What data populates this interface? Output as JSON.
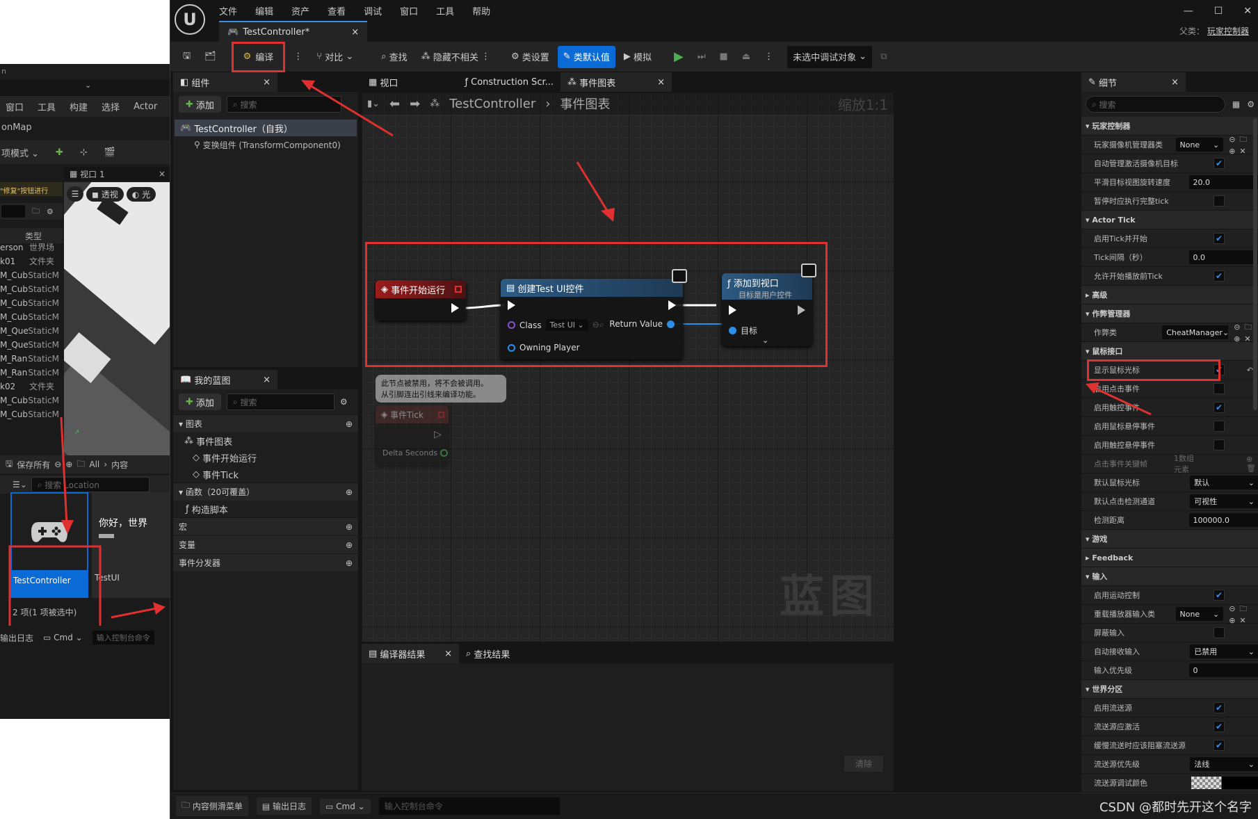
{
  "background_window": {
    "menu": [
      "窗口",
      "工具",
      "构建",
      "选择",
      "Actor"
    ],
    "map_label": "onMap",
    "mode_label": "项模式",
    "viewport_tab": "视口 1",
    "view_perspective": "透视",
    "view_lit": "光",
    "hint": "\"修复\"按钮进行",
    "type_header": "类型",
    "outliner_rows": [
      [
        "erson",
        "世界场"
      ],
      [
        "k01",
        "文件夹"
      ],
      [
        "M_Cub",
        "StaticM"
      ],
      [
        "M_Cub",
        "StaticM"
      ],
      [
        "M_Cub",
        "StaticM"
      ],
      [
        "M_Cub",
        "StaticM"
      ],
      [
        "M_Que",
        "StaticM"
      ],
      [
        "M_Que",
        "StaticM"
      ],
      [
        "M_Ran",
        "StaticM"
      ],
      [
        "M_Ran",
        "StaticM"
      ],
      [
        "k02",
        "文件夹"
      ],
      [
        "M_Cub",
        "StaticM"
      ],
      [
        "M_Cub",
        "StaticM"
      ]
    ],
    "save_all": "保存所有",
    "path_all": "All",
    "path_content": "内容",
    "search_placeholder": "搜索 Location",
    "assets": [
      {
        "name": "TestController",
        "selected": true
      },
      {
        "name": "TestUI",
        "preview_text": "你好，世界"
      }
    ],
    "items_count": "2 项(1 项被选中)",
    "output_log": "输出日志",
    "cmd": "Cmd",
    "console_placeholder": "输入控制台命令"
  },
  "title": {
    "menu": [
      "文件",
      "编辑",
      "资产",
      "查看",
      "调试",
      "窗口",
      "工具",
      "帮助"
    ],
    "tab": "TestController*",
    "parent_label": "父类：",
    "parent_value": "玩家控制器"
  },
  "toolbar": {
    "compile": "编译",
    "diff": "对比",
    "find": "查找",
    "hide_unrelated": "隐藏不相关",
    "class_settings": "类设置",
    "class_defaults": "类默认值",
    "simulate": "模拟",
    "debug_target": "未选中调试对象"
  },
  "components": {
    "tab": "组件",
    "add": "添加",
    "search_placeholder": "搜索",
    "root": "TestController（自我）",
    "child": "变换组件 (TransformComponent0)"
  },
  "my_blueprint": {
    "tab": "我的蓝图",
    "add": "添加",
    "search_placeholder": "搜索",
    "graphs": "图表",
    "event_graph": "事件图表",
    "event_begin": "事件开始运行",
    "event_tick": "事件Tick",
    "functions": "函数（20可覆盖）",
    "construction": "构造脚本",
    "macros": "宏",
    "variables": "变量",
    "dispatchers": "事件分发器"
  },
  "graph_tabs": {
    "viewport": "视口",
    "construction": "Construction Scr...",
    "event_graph": "事件图表"
  },
  "breadcrumb": {
    "bp": "TestController",
    "graph": "事件图表",
    "zoom": "缩放1:1"
  },
  "nodes": {
    "begin": {
      "title": "事件开始运行"
    },
    "create": {
      "title": "创建Test UI控件",
      "class_label": "Class",
      "class_value": "Test UI",
      "owning": "Owning Player",
      "return": "Return Value"
    },
    "add_viewport": {
      "title": "添加到视口",
      "subtitle": "目标是用户控件",
      "target": "目标"
    },
    "disabled_comment": "此节点被禁用，将不会被调用。\n从引脚连出引线来编译功能。",
    "tick": {
      "title": "事件Tick",
      "delta": "Delta Seconds"
    }
  },
  "watermark": "蓝图",
  "compiler": {
    "results": "编译器结果",
    "find_results": "查找结果",
    "clear": "清除"
  },
  "details": {
    "tab": "细节",
    "search_placeholder": "搜索",
    "sections": [
      {
        "title": "玩家控制器",
        "rows": [
          {
            "label": "玩家摄像机管理器类",
            "type": "drop",
            "value": "None",
            "icons": true
          },
          {
            "label": "自动管理激活摄像机目标",
            "type": "check",
            "value": true
          },
          {
            "label": "平滑目标视图旋转速度",
            "type": "input",
            "value": "20.0"
          },
          {
            "label": "暂停时应执行完整tick",
            "type": "check",
            "value": false
          }
        ]
      },
      {
        "title": "Actor Tick",
        "rows": [
          {
            "label": "启用Tick并开始",
            "type": "check",
            "value": true
          },
          {
            "label": "Tick间隔（秒）",
            "type": "input",
            "value": "0.0"
          },
          {
            "label": "允许开始播放前Tick",
            "type": "check",
            "value": true
          }
        ]
      },
      {
        "title": "高级",
        "collapsed": true,
        "rows": []
      },
      {
        "title": "作弊管理器",
        "rows": [
          {
            "label": "作弊类",
            "type": "drop",
            "value": "CheatManager",
            "icons": true
          }
        ]
      },
      {
        "title": "鼠标接口",
        "rows": [
          {
            "label": "显示鼠标光标",
            "type": "check",
            "value": true,
            "highlight": true
          },
          {
            "label": "启用点击事件",
            "type": "check",
            "value": false
          },
          {
            "label": "启用触控事件",
            "type": "check",
            "value": true
          },
          {
            "label": "启用鼠标悬停事件",
            "type": "check",
            "value": false
          },
          {
            "label": "启用触控悬停事件",
            "type": "check",
            "value": false
          },
          {
            "label": "点击事件关键帧",
            "type": "text",
            "value": "1数组元素",
            "dim": true
          },
          {
            "label": "默认鼠标光标",
            "type": "drop",
            "value": "默认"
          },
          {
            "label": "默认点击检测通道",
            "type": "drop",
            "value": "可视性"
          },
          {
            "label": "检测距离",
            "type": "input",
            "value": "100000.0"
          }
        ]
      },
      {
        "title": "游戏",
        "rows": []
      },
      {
        "title": "Feedback",
        "collapsed": true,
        "rows": []
      },
      {
        "title": "输入",
        "rows": [
          {
            "label": "启用运动控制",
            "type": "check",
            "value": true
          },
          {
            "label": "重载播放器输入类",
            "type": "drop",
            "value": "None",
            "icons": true
          },
          {
            "label": "屏蔽输入",
            "type": "check",
            "value": false
          },
          {
            "label": "自动接收输入",
            "type": "drop",
            "value": "已禁用"
          },
          {
            "label": "输入优先级",
            "type": "input",
            "value": "0"
          }
        ]
      },
      {
        "title": "世界分区",
        "rows": [
          {
            "label": "启用流送源",
            "type": "check",
            "value": true
          },
          {
            "label": "流送源应激活",
            "type": "check",
            "value": true
          },
          {
            "label": "缓慢流送时应该阻塞流送源",
            "type": "check",
            "value": true
          },
          {
            "label": "流送源优先级",
            "type": "drop",
            "value": "法线"
          },
          {
            "label": "流送源调试颜色",
            "type": "color",
            "value": ""
          }
        ]
      }
    ]
  },
  "statusbar": {
    "content_drawer": "内容侧滑菜单",
    "output_log": "输出日志",
    "cmd": "Cmd",
    "console_placeholder": "输入控制台命令",
    "watermark": "CSDN @都时先开这个名字"
  },
  "colors": {
    "accent": "#0a6ad6",
    "highlight": "#e03030",
    "event_node": "#8b1a1a",
    "function_node": "#2d5a82"
  }
}
